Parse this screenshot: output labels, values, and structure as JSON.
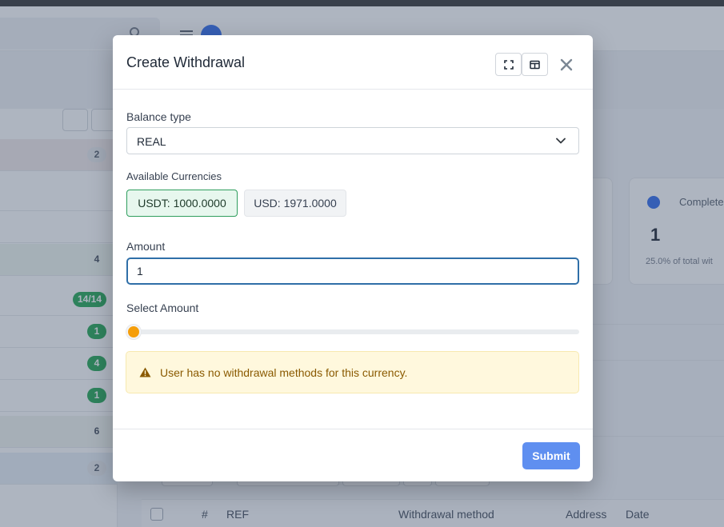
{
  "modal": {
    "title": "Create Withdrawal",
    "balance_type": {
      "label": "Balance type",
      "selected": "REAL"
    },
    "currencies": {
      "label": "Available Currencies",
      "items": [
        {
          "label": "USDT: 1000.0000",
          "active": true
        },
        {
          "label": "USD: 1971.0000",
          "active": false
        }
      ]
    },
    "amount": {
      "label": "Amount",
      "value": "1"
    },
    "select_amount": {
      "label": "Select Amount",
      "slider_fraction": 0.0
    },
    "alert": {
      "icon": "warning-icon",
      "text": "User has no withdrawal methods for this currency."
    },
    "submit_label": "Submit"
  },
  "background": {
    "badges": [
      "2",
      "4",
      "14/14",
      "1",
      "4",
      "1",
      "6",
      "2"
    ],
    "stat_card": {
      "title": "Complete",
      "value": "1",
      "subtitle": "25.0% of total wit"
    },
    "table_headers": [
      "#",
      "REF",
      "Withdrawal method",
      "Address",
      "Date"
    ]
  },
  "colors": {
    "accent": "#5f8ff0",
    "success_chip": "#2f9e5e",
    "warning_text": "#8a5a00",
    "slider_thumb": "#f59e0b"
  }
}
